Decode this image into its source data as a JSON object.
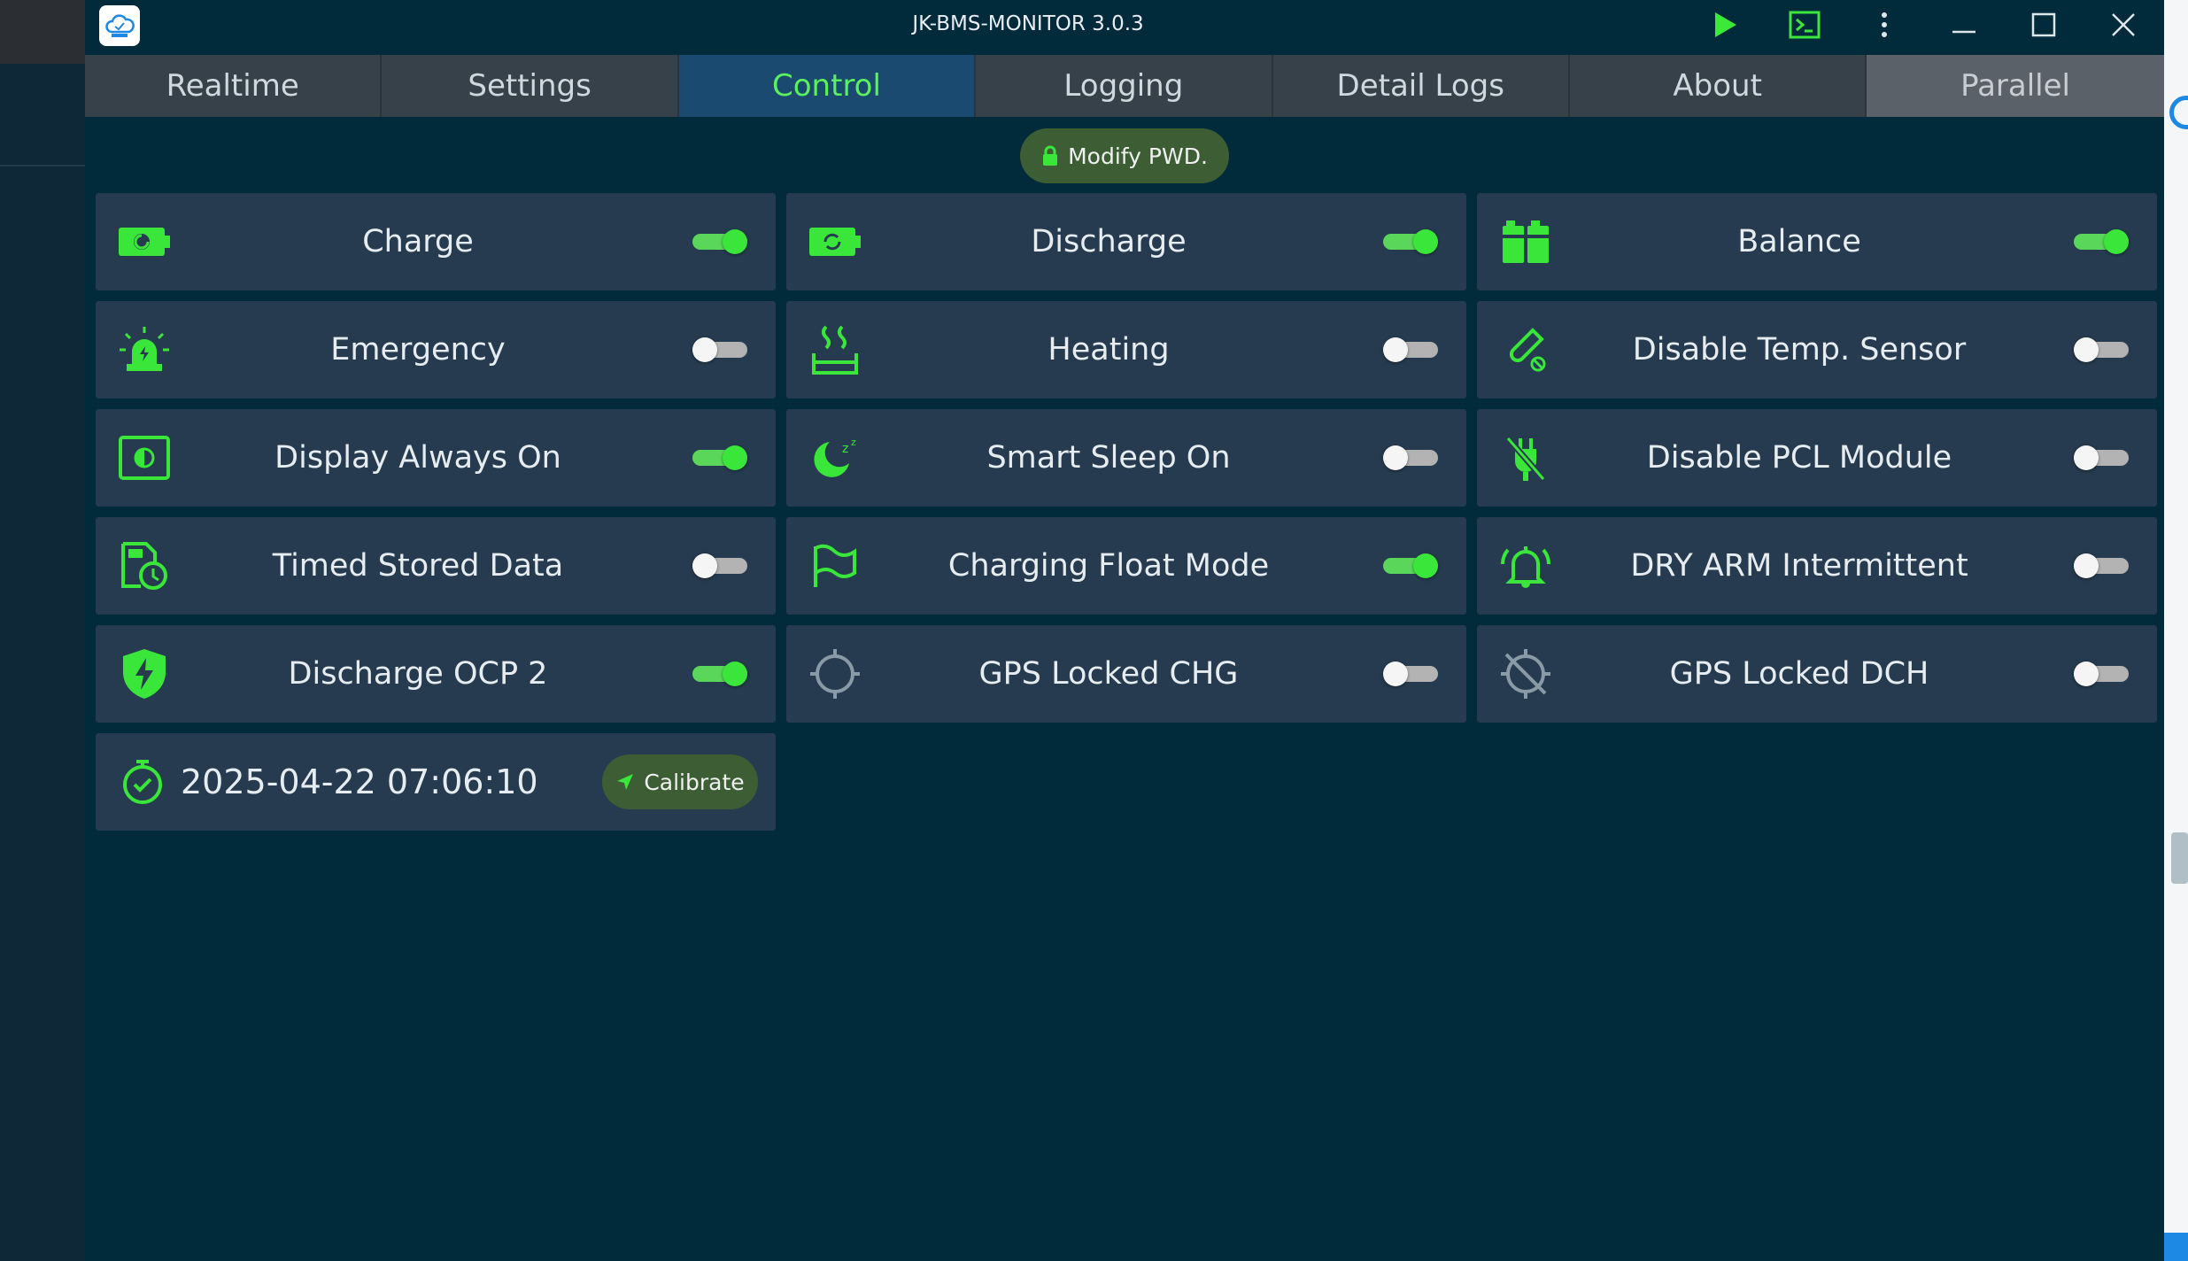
{
  "app": {
    "title": "JK-BMS-MONITOR 3.0.3",
    "icons": {
      "logo": "cloud-logo-icon",
      "run": "play-icon",
      "console": "terminal-icon",
      "menu": "more-vertical-icon",
      "minimize": "minimize-icon",
      "maximize": "maximize-icon",
      "close": "close-icon"
    }
  },
  "tabs": [
    {
      "label": "Realtime",
      "active": false
    },
    {
      "label": "Settings",
      "active": false
    },
    {
      "label": "Control",
      "active": true
    },
    {
      "label": "Logging",
      "active": false
    },
    {
      "label": "Detail Logs",
      "active": false
    },
    {
      "label": "About",
      "active": false
    },
    {
      "label": "Parallel",
      "active": false
    }
  ],
  "modify_pwd": {
    "label": "Modify PWD.",
    "icon": "lock-icon"
  },
  "controls": [
    {
      "label": "Charge",
      "icon": "battery-charge-icon",
      "on": true
    },
    {
      "label": "Discharge",
      "icon": "battery-discharge-icon",
      "on": true
    },
    {
      "label": "Balance",
      "icon": "battery-balance-icon",
      "on": true
    },
    {
      "label": "Emergency",
      "icon": "emergency-siren-icon",
      "on": false
    },
    {
      "label": "Heating",
      "icon": "heating-icon",
      "on": false
    },
    {
      "label": "Disable Temp. Sensor",
      "icon": "temp-sensor-off-icon",
      "on": false
    },
    {
      "label": "Display Always On",
      "icon": "display-icon",
      "on": true
    },
    {
      "label": "Smart Sleep On",
      "icon": "sleep-moon-icon",
      "on": false
    },
    {
      "label": "Disable PCL Module",
      "icon": "plug-off-icon",
      "on": false
    },
    {
      "label": "Timed Stored Data",
      "icon": "file-clock-icon",
      "on": false
    },
    {
      "label": "Charging Float Mode",
      "icon": "flag-icon",
      "on": true
    },
    {
      "label": "DRY ARM Intermittent",
      "icon": "alarm-bell-icon",
      "on": false
    },
    {
      "label": "Discharge OCP 2",
      "icon": "shield-bolt-icon",
      "on": true
    },
    {
      "label": "GPS Locked CHG",
      "icon": "gps-crosshair-icon",
      "on": false
    },
    {
      "label": "GPS Locked DCH",
      "icon": "gps-off-icon",
      "on": false
    }
  ],
  "clock": {
    "datetime": "2025-04-22 07:06:10",
    "icon": "timer-check-icon"
  },
  "calibrate": {
    "label": "Calibrate",
    "icon": "send-icon"
  },
  "colors": {
    "accent": "#39e639",
    "background": "#012a3b",
    "card": "#263b4f",
    "active_tab": "#1b4a70"
  }
}
